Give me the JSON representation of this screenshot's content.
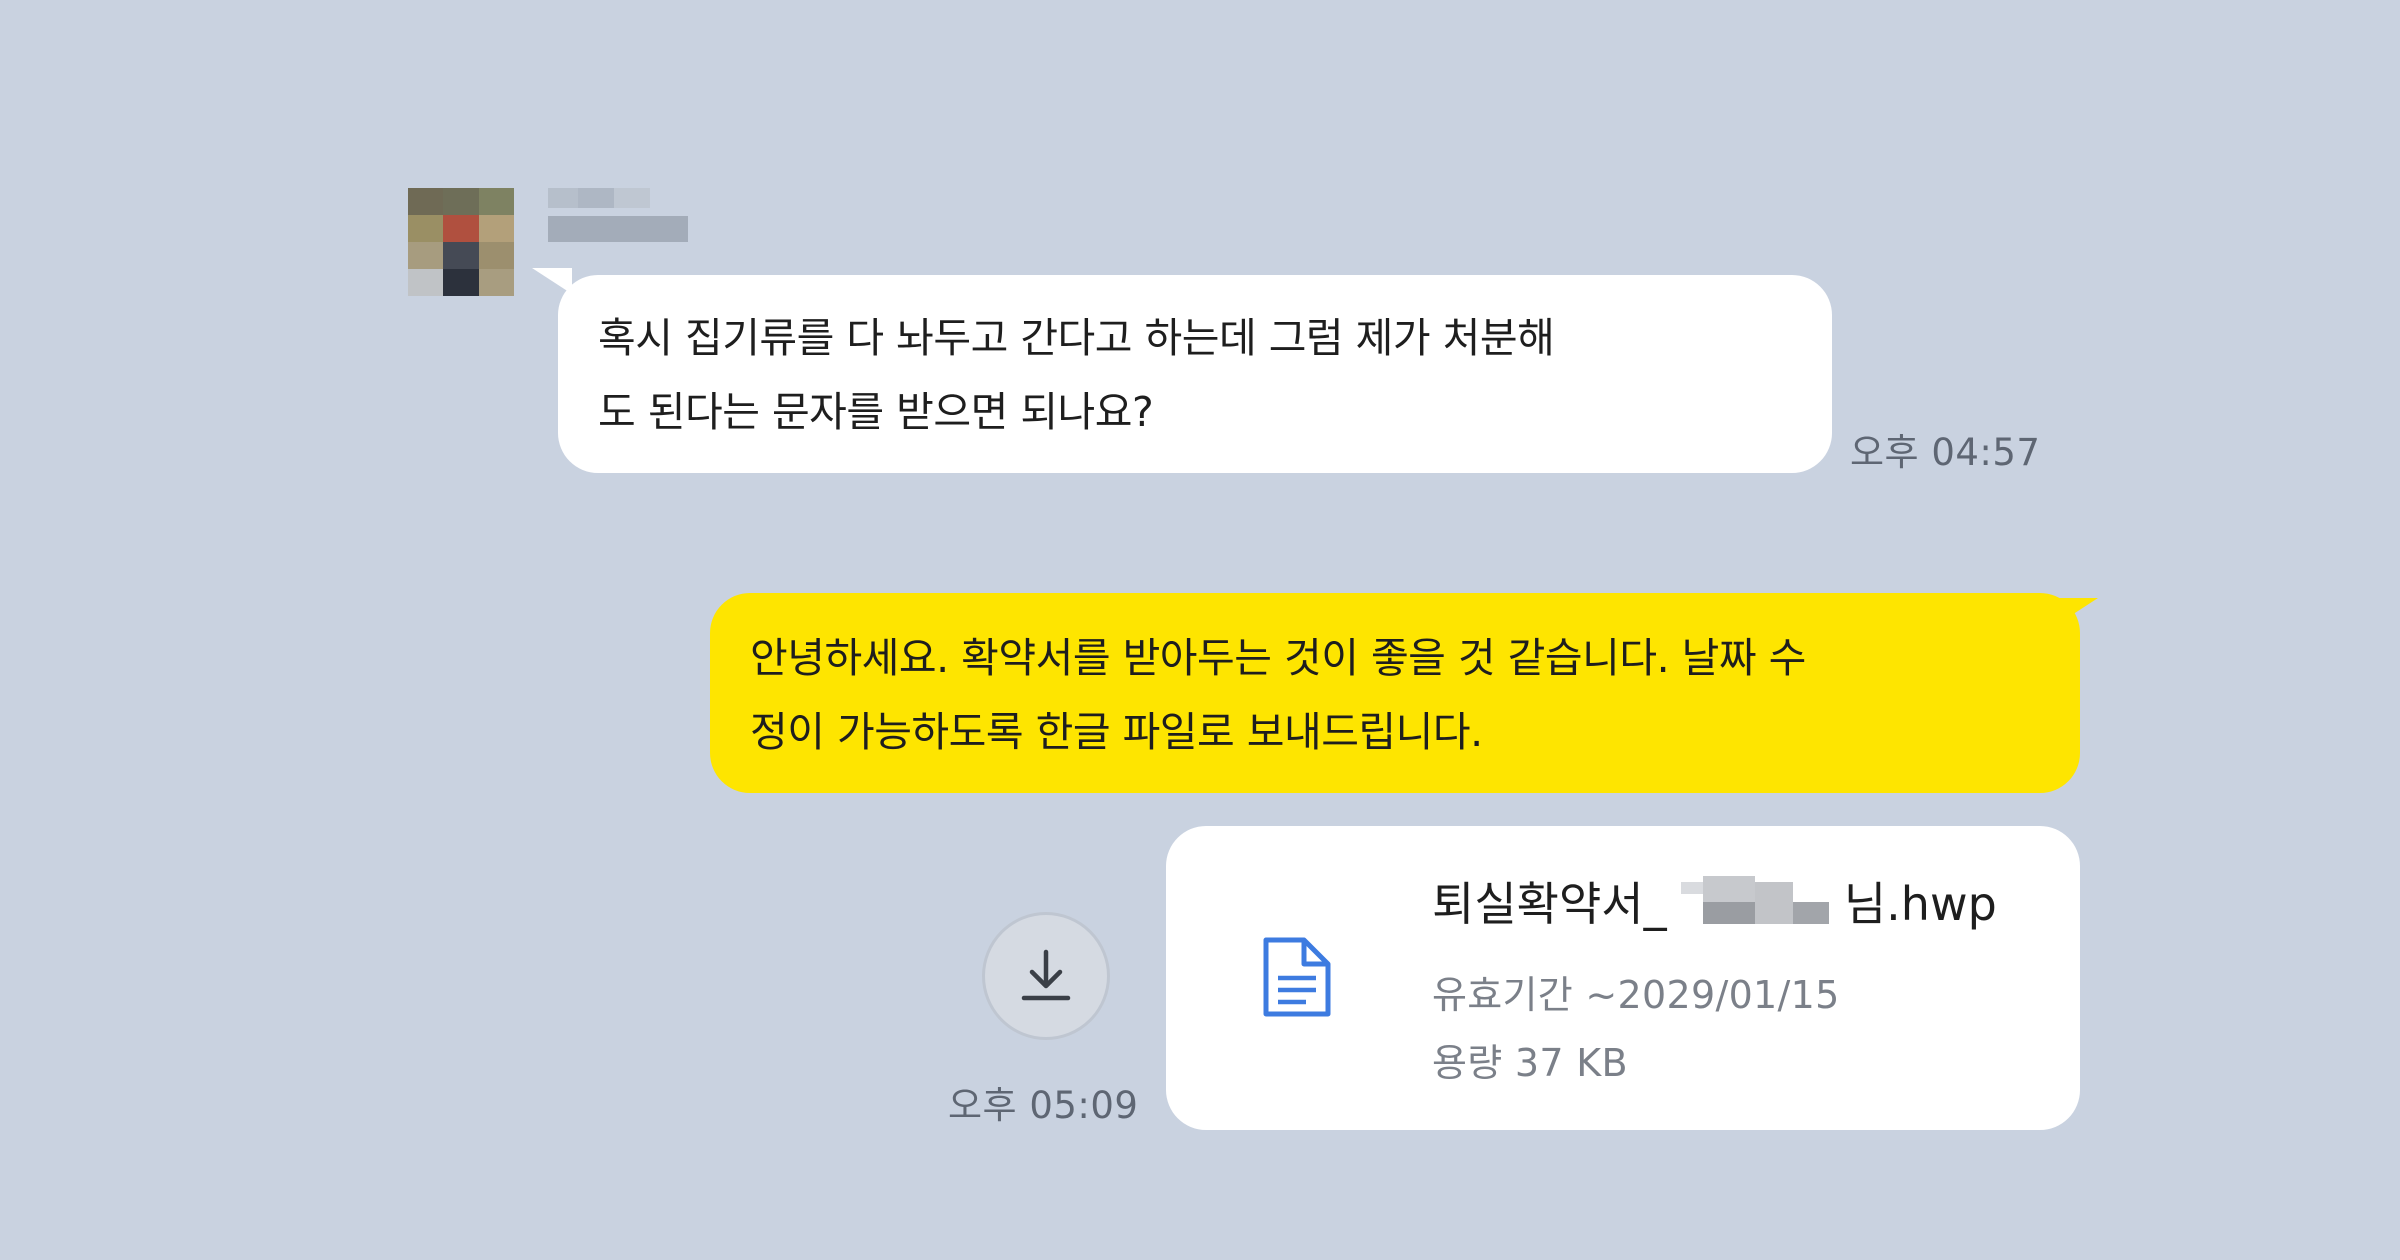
{
  "incoming": {
    "sender_name_redacted": true,
    "message_lines": [
      "혹시 집기류를 다 놔두고 간다고 하는데 그럼 제가 처분해",
      "도 된다는 문자를 받으면 되나요?"
    ],
    "time": "오후 04:57"
  },
  "outgoing": {
    "message_lines": [
      "안녕하세요. 확약서를 받아두는 것이 좋을 것 같습니다. 날짜 수",
      "정이 가능하도록 한글 파일로 보내드립니다."
    ],
    "time": "오후 05:09"
  },
  "file": {
    "name_prefix": "퇴실확약서_",
    "name_suffix": "님.hwp",
    "expiry": "유효기간 ~2029/01/15",
    "size": "용량 37 KB",
    "icon": "document-icon",
    "download_icon": "download-icon"
  },
  "colors": {
    "background": "#c9d2e0",
    "incoming_bubble": "#ffffff",
    "outgoing_bubble": "#fee500",
    "file_icon": "#3d7be0"
  }
}
